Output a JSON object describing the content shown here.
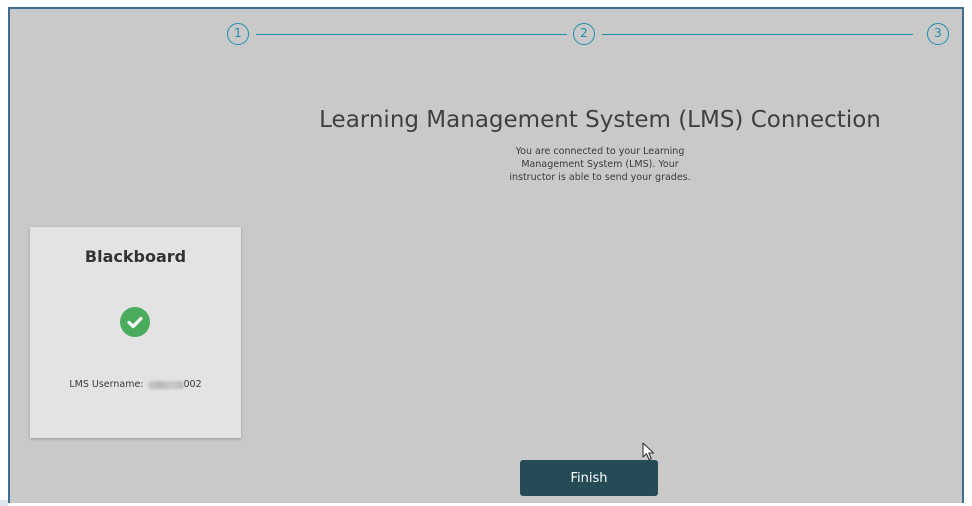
{
  "stepper": {
    "steps": [
      "1",
      "2",
      "3"
    ],
    "accent_color": "#1f8fab"
  },
  "main": {
    "title": "Learning Management System (LMS) Connection",
    "description_lines": [
      "You are connected to your Learning",
      "Management System (LMS). Your",
      "instructor is able to send your grades."
    ]
  },
  "lms_card": {
    "name": "Blackboard",
    "status_icon": "check-circle-icon",
    "status_color": "#4aab5c",
    "username_label": "LMS Username:",
    "username_visible_suffix": "002"
  },
  "actions": {
    "finish_label": "Finish",
    "finish_color": "#254b57"
  }
}
